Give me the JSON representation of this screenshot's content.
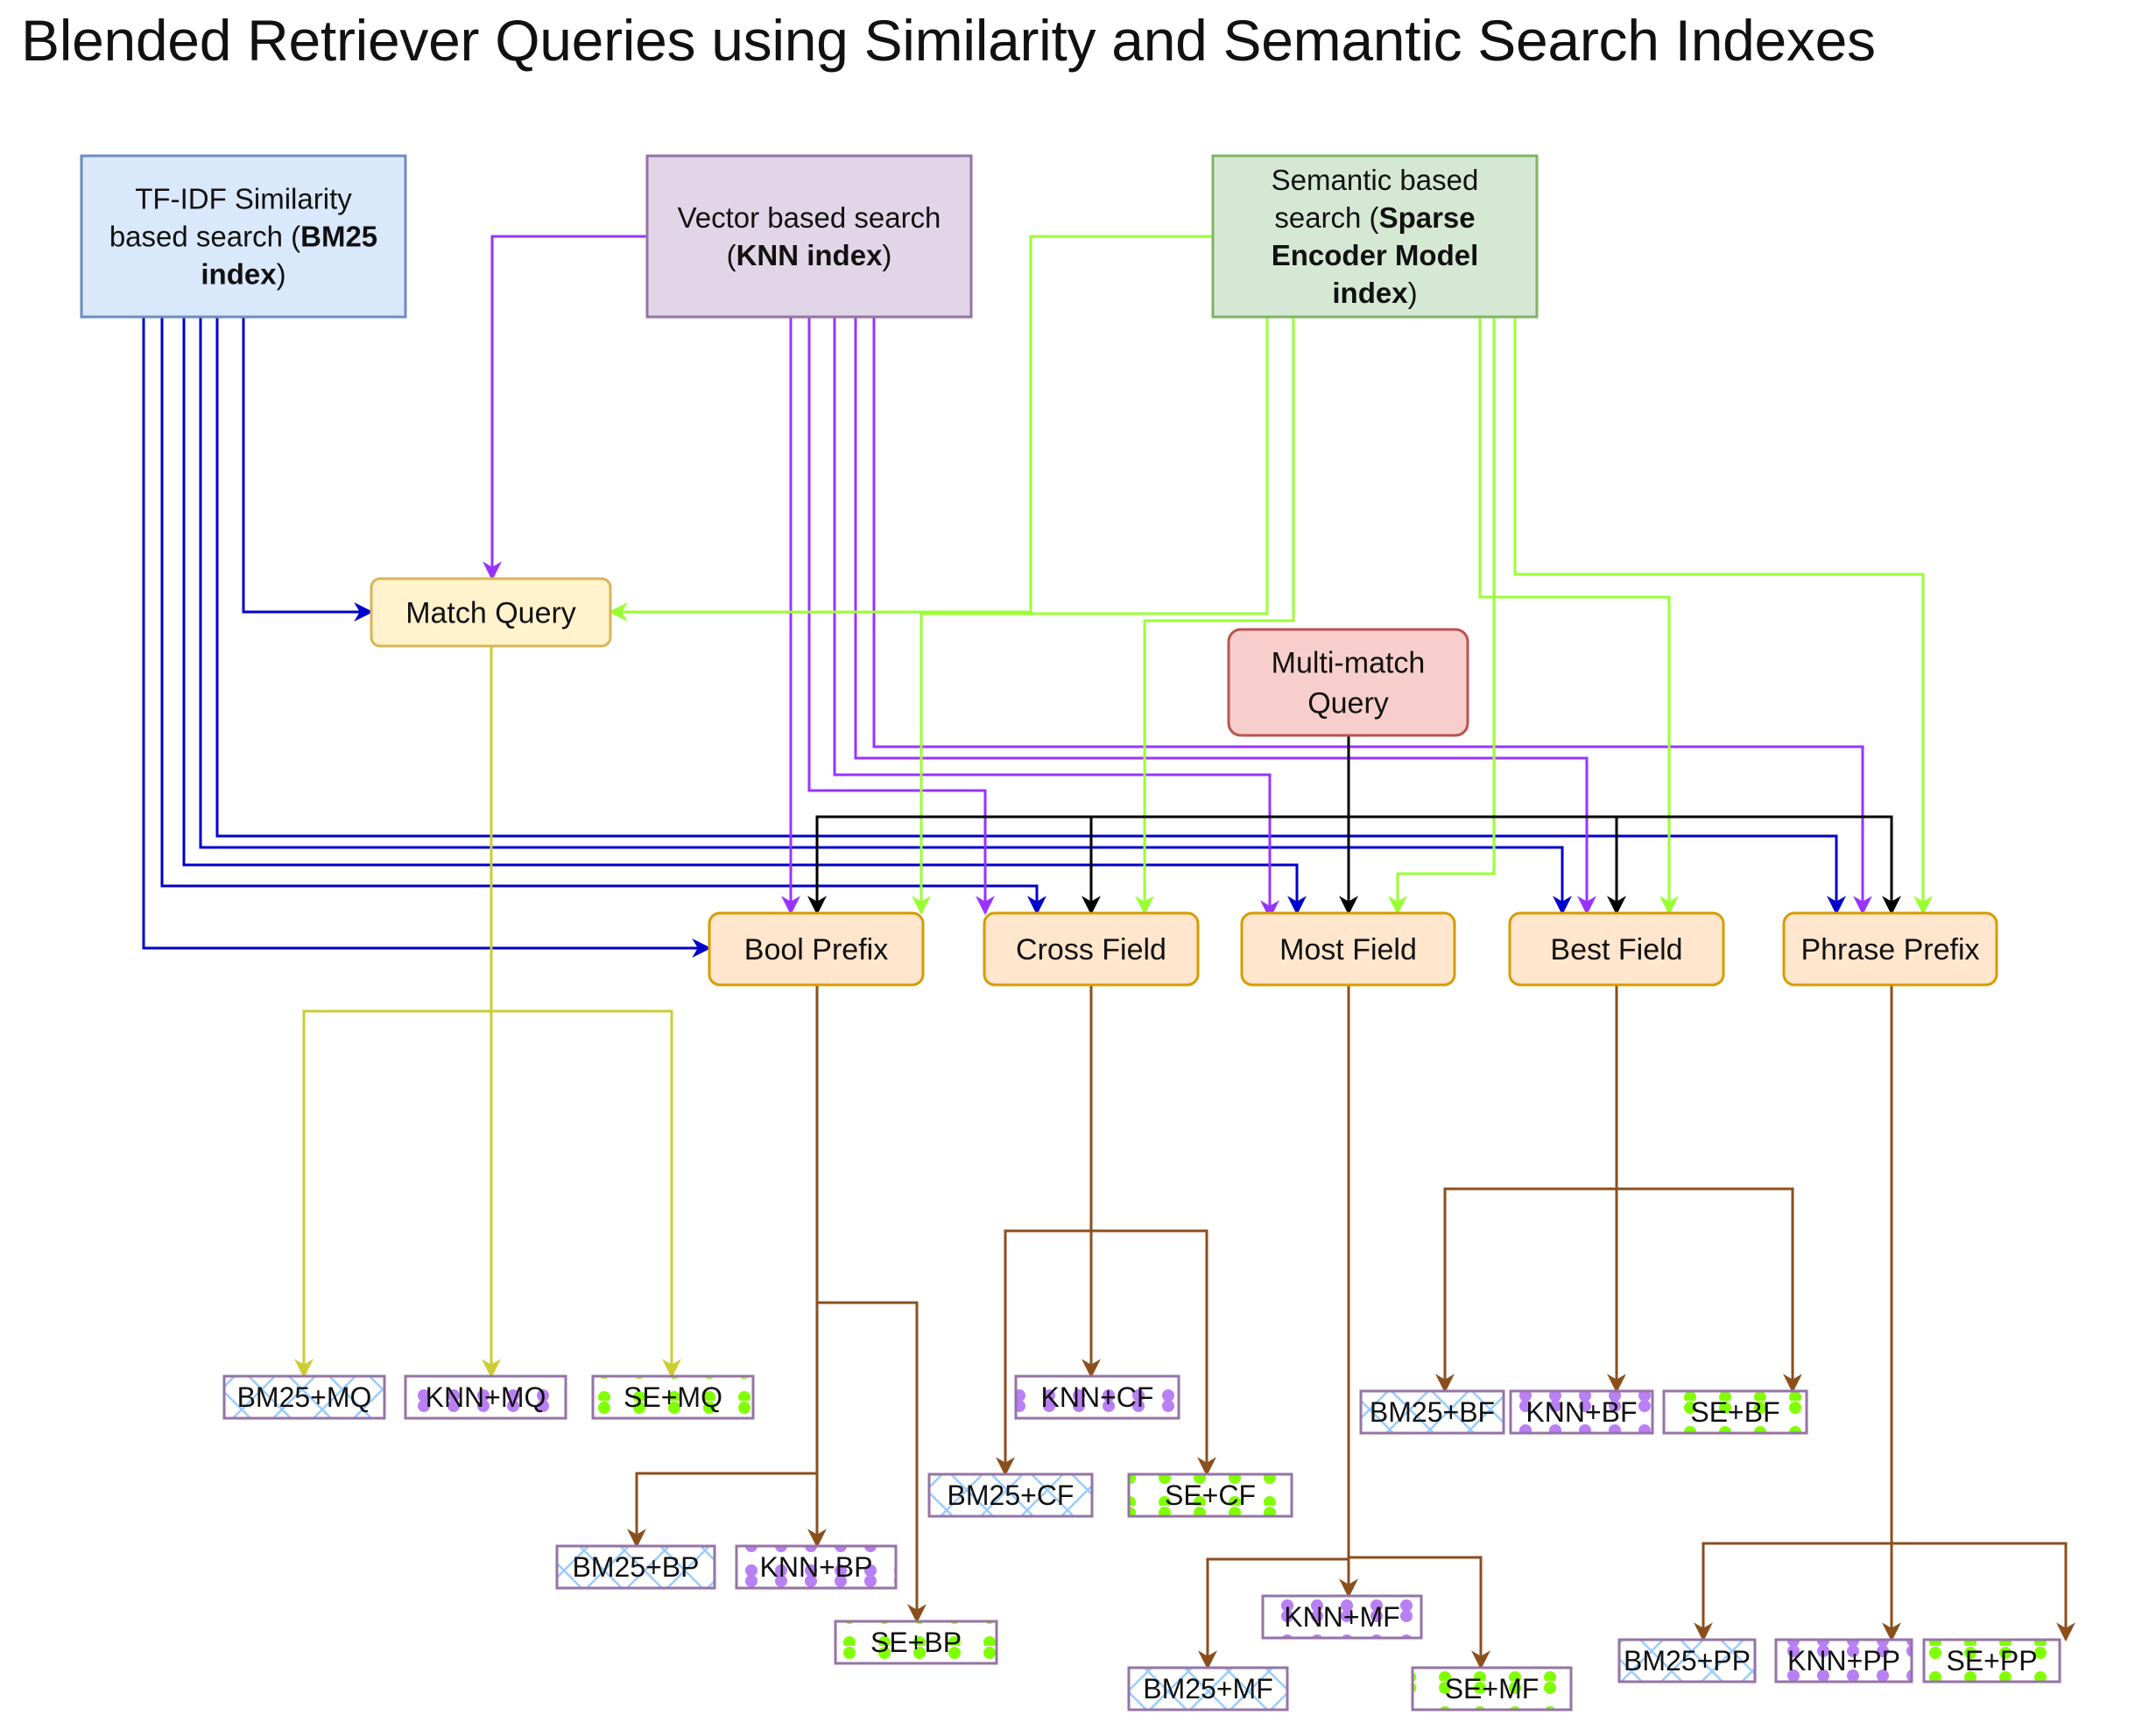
{
  "title": "Blended Retriever Queries using Similarity and Semantic Search Indexes",
  "colors": {
    "bm25": "#0000CC",
    "knn": "#9933FF",
    "se": "#99FF33",
    "multi_match": "#000000",
    "match_query_out": "#CCCC33",
    "result_edges": "#8B4F1E",
    "source_bm25_fill": "#DAE8FC",
    "source_bm25_stroke": "#6C8EBF",
    "source_knn_fill": "#E1D5E7",
    "source_knn_stroke": "#9673A6",
    "source_se_fill": "#D5E8D4",
    "source_se_stroke": "#82B366",
    "match_query_fill": "#FFF2CC",
    "match_query_stroke": "#D6B656",
    "multi_match_fill": "#F8CECC",
    "multi_match_stroke": "#B85450",
    "query_type_fill": "#FFE6CC",
    "query_type_stroke": "#D79B00",
    "result_stroke": "#9673A6",
    "pattern_bm25": "#99CCFF",
    "pattern_knn": "#B97FF5",
    "pattern_se": "#80FF00"
  },
  "sources": [
    {
      "id": "bm25",
      "lines": [
        [
          {
            "t": "TF-IDF Similarity",
            "b": false
          }
        ],
        [
          {
            "t": "based search (",
            "b": false
          },
          {
            "t": "BM25",
            "b": true
          }
        ],
        [
          {
            "t": "index",
            "b": true
          },
          {
            "t": ")",
            "b": false
          }
        ]
      ]
    },
    {
      "id": "knn",
      "lines": [
        [
          {
            "t": "Vector based search",
            "b": false
          }
        ],
        [
          {
            "t": "(",
            "b": false
          },
          {
            "t": "KNN index",
            "b": true
          },
          {
            "t": ")",
            "b": false
          }
        ]
      ]
    },
    {
      "id": "se",
      "lines": [
        [
          {
            "t": "Semantic based",
            "b": false
          }
        ],
        [
          {
            "t": "search (",
            "b": false
          },
          {
            "t": "Sparse",
            "b": true
          }
        ],
        [
          {
            "t": "Encoder Model",
            "b": true
          }
        ],
        [
          {
            "t": "index",
            "b": true
          },
          {
            "t": ")",
            "b": false
          }
        ]
      ]
    }
  ],
  "match_query": {
    "label": "Match Query"
  },
  "multi_match": {
    "lines": [
      "Multi-match",
      "Query"
    ]
  },
  "query_types": [
    {
      "id": "bp",
      "label": "Bool Prefix"
    },
    {
      "id": "cf",
      "label": "Cross Field"
    },
    {
      "id": "mf",
      "label": "Most Field"
    },
    {
      "id": "bf",
      "label": "Best Field"
    },
    {
      "id": "pp",
      "label": "Phrase Prefix"
    }
  ],
  "results": [
    {
      "id": "bm25-mq",
      "label": "BM25+MQ",
      "pattern": "bm25"
    },
    {
      "id": "knn-mq",
      "label": "KNN+MQ",
      "pattern": "knn"
    },
    {
      "id": "se-mq",
      "label": "SE+MQ",
      "pattern": "se"
    },
    {
      "id": "bm25-bp",
      "label": "BM25+BP",
      "pattern": "bm25"
    },
    {
      "id": "knn-bp",
      "label": "KNN+BP",
      "pattern": "knn"
    },
    {
      "id": "se-bp",
      "label": "SE+BP",
      "pattern": "se"
    },
    {
      "id": "bm25-cf",
      "label": "BM25+CF",
      "pattern": "bm25"
    },
    {
      "id": "knn-cf",
      "label": "KNN+CF",
      "pattern": "knn"
    },
    {
      "id": "se-cf",
      "label": "SE+CF",
      "pattern": "se"
    },
    {
      "id": "bm25-mf",
      "label": "BM25+MF",
      "pattern": "bm25"
    },
    {
      "id": "knn-mf",
      "label": "KNN+MF",
      "pattern": "knn"
    },
    {
      "id": "se-mf",
      "label": "SE+MF",
      "pattern": "se"
    },
    {
      "id": "bm25-bf",
      "label": "BM25+BF",
      "pattern": "bm25"
    },
    {
      "id": "knn-bf",
      "label": "KNN+BF",
      "pattern": "knn"
    },
    {
      "id": "se-bf",
      "label": "SE+BF",
      "pattern": "se"
    },
    {
      "id": "bm25-pp",
      "label": "BM25+PP",
      "pattern": "bm25"
    },
    {
      "id": "knn-pp",
      "label": "KNN+PP",
      "pattern": "knn"
    },
    {
      "id": "se-pp",
      "label": "SE+PP",
      "pattern": "se"
    }
  ],
  "edges": [
    {
      "from": "bm25",
      "to": "match_query"
    },
    {
      "from": "bm25",
      "to": "bp"
    },
    {
      "from": "bm25",
      "to": "cf"
    },
    {
      "from": "bm25",
      "to": "mf"
    },
    {
      "from": "bm25",
      "to": "bf"
    },
    {
      "from": "bm25",
      "to": "pp"
    },
    {
      "from": "knn",
      "to": "match_query"
    },
    {
      "from": "knn",
      "to": "bp"
    },
    {
      "from": "knn",
      "to": "cf"
    },
    {
      "from": "knn",
      "to": "mf"
    },
    {
      "from": "knn",
      "to": "bf"
    },
    {
      "from": "knn",
      "to": "pp"
    },
    {
      "from": "se",
      "to": "match_query"
    },
    {
      "from": "se",
      "to": "bp"
    },
    {
      "from": "se",
      "to": "cf"
    },
    {
      "from": "se",
      "to": "mf"
    },
    {
      "from": "se",
      "to": "bf"
    },
    {
      "from": "se",
      "to": "pp"
    },
    {
      "from": "multi_match",
      "to": "bp"
    },
    {
      "from": "multi_match",
      "to": "cf"
    },
    {
      "from": "multi_match",
      "to": "mf"
    },
    {
      "from": "multi_match",
      "to": "bf"
    },
    {
      "from": "multi_match",
      "to": "pp"
    },
    {
      "from": "match_query",
      "to": "bm25-mq"
    },
    {
      "from": "match_query",
      "to": "knn-mq"
    },
    {
      "from": "match_query",
      "to": "se-mq"
    },
    {
      "from": "bp",
      "to": "bm25-bp"
    },
    {
      "from": "bp",
      "to": "knn-bp"
    },
    {
      "from": "bp",
      "to": "se-bp"
    },
    {
      "from": "cf",
      "to": "bm25-cf"
    },
    {
      "from": "cf",
      "to": "knn-cf"
    },
    {
      "from": "cf",
      "to": "se-cf"
    },
    {
      "from": "mf",
      "to": "bm25-mf"
    },
    {
      "from": "mf",
      "to": "knn-mf"
    },
    {
      "from": "mf",
      "to": "se-mf"
    },
    {
      "from": "bf",
      "to": "bm25-bf"
    },
    {
      "from": "bf",
      "to": "knn-bf"
    },
    {
      "from": "bf",
      "to": "se-bf"
    },
    {
      "from": "pp",
      "to": "bm25-pp"
    },
    {
      "from": "pp",
      "to": "knn-pp"
    },
    {
      "from": "pp",
      "to": "se-pp"
    }
  ]
}
